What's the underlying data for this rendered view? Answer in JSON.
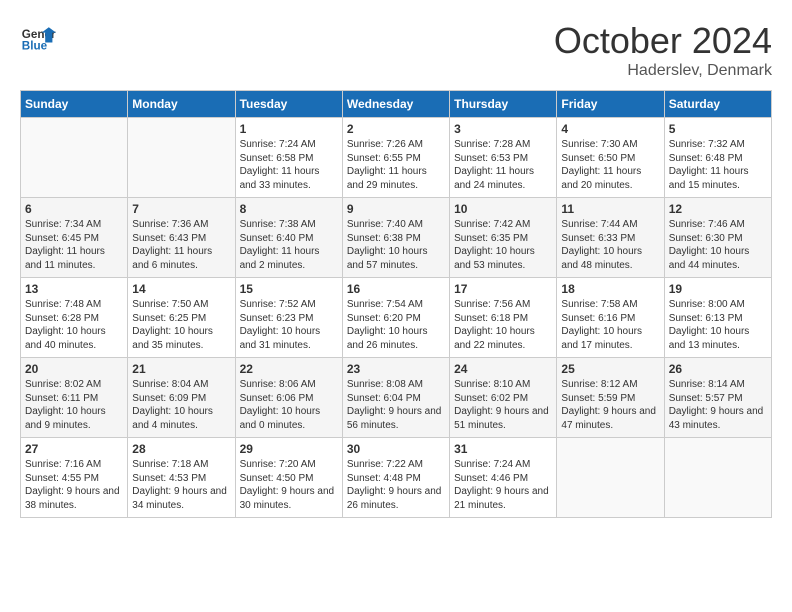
{
  "header": {
    "logo_line1": "General",
    "logo_line2": "Blue",
    "month_title": "October 2024",
    "subtitle": "Haderslev, Denmark"
  },
  "days_of_week": [
    "Sunday",
    "Monday",
    "Tuesday",
    "Wednesday",
    "Thursday",
    "Friday",
    "Saturday"
  ],
  "weeks": [
    [
      {
        "day": "",
        "content": ""
      },
      {
        "day": "",
        "content": ""
      },
      {
        "day": "1",
        "content": "Sunrise: 7:24 AM\nSunset: 6:58 PM\nDaylight: 11 hours\nand 33 minutes."
      },
      {
        "day": "2",
        "content": "Sunrise: 7:26 AM\nSunset: 6:55 PM\nDaylight: 11 hours\nand 29 minutes."
      },
      {
        "day": "3",
        "content": "Sunrise: 7:28 AM\nSunset: 6:53 PM\nDaylight: 11 hours\nand 24 minutes."
      },
      {
        "day": "4",
        "content": "Sunrise: 7:30 AM\nSunset: 6:50 PM\nDaylight: 11 hours\nand 20 minutes."
      },
      {
        "day": "5",
        "content": "Sunrise: 7:32 AM\nSunset: 6:48 PM\nDaylight: 11 hours\nand 15 minutes."
      }
    ],
    [
      {
        "day": "6",
        "content": "Sunrise: 7:34 AM\nSunset: 6:45 PM\nDaylight: 11 hours\nand 11 minutes."
      },
      {
        "day": "7",
        "content": "Sunrise: 7:36 AM\nSunset: 6:43 PM\nDaylight: 11 hours\nand 6 minutes."
      },
      {
        "day": "8",
        "content": "Sunrise: 7:38 AM\nSunset: 6:40 PM\nDaylight: 11 hours\nand 2 minutes."
      },
      {
        "day": "9",
        "content": "Sunrise: 7:40 AM\nSunset: 6:38 PM\nDaylight: 10 hours\nand 57 minutes."
      },
      {
        "day": "10",
        "content": "Sunrise: 7:42 AM\nSunset: 6:35 PM\nDaylight: 10 hours\nand 53 minutes."
      },
      {
        "day": "11",
        "content": "Sunrise: 7:44 AM\nSunset: 6:33 PM\nDaylight: 10 hours\nand 48 minutes."
      },
      {
        "day": "12",
        "content": "Sunrise: 7:46 AM\nSunset: 6:30 PM\nDaylight: 10 hours\nand 44 minutes."
      }
    ],
    [
      {
        "day": "13",
        "content": "Sunrise: 7:48 AM\nSunset: 6:28 PM\nDaylight: 10 hours\nand 40 minutes."
      },
      {
        "day": "14",
        "content": "Sunrise: 7:50 AM\nSunset: 6:25 PM\nDaylight: 10 hours\nand 35 minutes."
      },
      {
        "day": "15",
        "content": "Sunrise: 7:52 AM\nSunset: 6:23 PM\nDaylight: 10 hours\nand 31 minutes."
      },
      {
        "day": "16",
        "content": "Sunrise: 7:54 AM\nSunset: 6:20 PM\nDaylight: 10 hours\nand 26 minutes."
      },
      {
        "day": "17",
        "content": "Sunrise: 7:56 AM\nSunset: 6:18 PM\nDaylight: 10 hours\nand 22 minutes."
      },
      {
        "day": "18",
        "content": "Sunrise: 7:58 AM\nSunset: 6:16 PM\nDaylight: 10 hours\nand 17 minutes."
      },
      {
        "day": "19",
        "content": "Sunrise: 8:00 AM\nSunset: 6:13 PM\nDaylight: 10 hours\nand 13 minutes."
      }
    ],
    [
      {
        "day": "20",
        "content": "Sunrise: 8:02 AM\nSunset: 6:11 PM\nDaylight: 10 hours\nand 9 minutes."
      },
      {
        "day": "21",
        "content": "Sunrise: 8:04 AM\nSunset: 6:09 PM\nDaylight: 10 hours\nand 4 minutes."
      },
      {
        "day": "22",
        "content": "Sunrise: 8:06 AM\nSunset: 6:06 PM\nDaylight: 10 hours\nand 0 minutes."
      },
      {
        "day": "23",
        "content": "Sunrise: 8:08 AM\nSunset: 6:04 PM\nDaylight: 9 hours\nand 56 minutes."
      },
      {
        "day": "24",
        "content": "Sunrise: 8:10 AM\nSunset: 6:02 PM\nDaylight: 9 hours\nand 51 minutes."
      },
      {
        "day": "25",
        "content": "Sunrise: 8:12 AM\nSunset: 5:59 PM\nDaylight: 9 hours\nand 47 minutes."
      },
      {
        "day": "26",
        "content": "Sunrise: 8:14 AM\nSunset: 5:57 PM\nDaylight: 9 hours\nand 43 minutes."
      }
    ],
    [
      {
        "day": "27",
        "content": "Sunrise: 7:16 AM\nSunset: 4:55 PM\nDaylight: 9 hours\nand 38 minutes."
      },
      {
        "day": "28",
        "content": "Sunrise: 7:18 AM\nSunset: 4:53 PM\nDaylight: 9 hours\nand 34 minutes."
      },
      {
        "day": "29",
        "content": "Sunrise: 7:20 AM\nSunset: 4:50 PM\nDaylight: 9 hours\nand 30 minutes."
      },
      {
        "day": "30",
        "content": "Sunrise: 7:22 AM\nSunset: 4:48 PM\nDaylight: 9 hours\nand 26 minutes."
      },
      {
        "day": "31",
        "content": "Sunrise: 7:24 AM\nSunset: 4:46 PM\nDaylight: 9 hours\nand 21 minutes."
      },
      {
        "day": "",
        "content": ""
      },
      {
        "day": "",
        "content": ""
      }
    ]
  ]
}
